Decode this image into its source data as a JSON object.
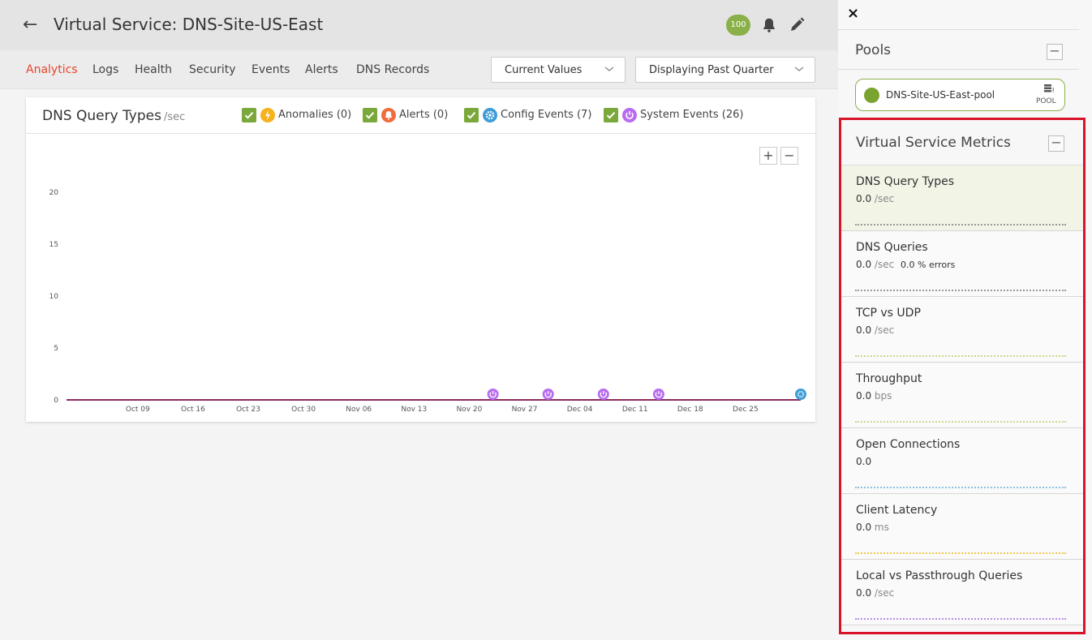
{
  "header": {
    "title": "Virtual Service: DNS-Site-US-East",
    "health_score": "100"
  },
  "tabs": [
    {
      "label": "Analytics",
      "active": true
    },
    {
      "label": "Logs"
    },
    {
      "label": "Health"
    },
    {
      "label": "Security"
    },
    {
      "label": "Events"
    },
    {
      "label": "Alerts"
    },
    {
      "label": "DNS Records"
    }
  ],
  "controls": {
    "values_dropdown": "Current Values",
    "range_dropdown": "Displaying Past Quarter"
  },
  "chart_card": {
    "title": "DNS Query Types",
    "unit": "/sec",
    "legend": [
      {
        "label": "Anomalies (0)",
        "color": "#f5b21e",
        "icon": "lightning-icon"
      },
      {
        "label": "Alerts (0)",
        "color": "#ef6c3c",
        "icon": "bell-icon"
      },
      {
        "label": "Config Events (7)",
        "color": "#3f9dd6",
        "icon": "gear-icon"
      },
      {
        "label": "System Events (26)",
        "color": "#b86cf0",
        "icon": "power-icon"
      }
    ],
    "zoom_in": "+",
    "zoom_out": "−"
  },
  "chart_data": {
    "type": "line",
    "title": "DNS Query Types",
    "ylabel": "",
    "xlabel": "",
    "ylim": [
      0,
      20
    ],
    "y_ticks": [
      0,
      5,
      10,
      15,
      20
    ],
    "x_ticks": [
      "Oct 09",
      "Oct 16",
      "Oct 23",
      "Oct 30",
      "Nov 06",
      "Nov 13",
      "Nov 20",
      "Nov 27",
      "Dec 04",
      "Dec 11",
      "Dec 18",
      "Dec 25"
    ],
    "series": [
      {
        "color": "#8b2c5c",
        "values": [
          0,
          0,
          0,
          0,
          0,
          0,
          0,
          0,
          0,
          0,
          0,
          0
        ]
      }
    ],
    "event_markers": [
      {
        "type": "system",
        "color": "#b86cf0",
        "date": "Nov 23"
      },
      {
        "type": "system",
        "color": "#b86cf0",
        "date": "Nov 30"
      },
      {
        "type": "system",
        "color": "#b86cf0",
        "date": "Dec 07"
      },
      {
        "type": "system",
        "color": "#b86cf0",
        "date": "Dec 14"
      },
      {
        "type": "config",
        "color": "#3f9dd6",
        "date": "Jan 01"
      }
    ]
  },
  "sidebar": {
    "close": "×",
    "pools_title": "Pools",
    "pool": {
      "name": "DNS-Site-US-East-pool",
      "type": "POOL"
    },
    "metrics_title": "Virtual Service Metrics",
    "metrics": [
      {
        "name": "DNS Query Types",
        "value": "0.0",
        "unit": "/sec",
        "extra": "",
        "selected": true,
        "spark_color": "#999999"
      },
      {
        "name": "DNS Queries",
        "value": "0.0",
        "unit": "/sec",
        "extra": "0.0 % errors",
        "spark_color": "#999999"
      },
      {
        "name": "TCP vs UDP",
        "value": "0.0",
        "unit": "/sec",
        "extra": "",
        "spark_color": "#c7d98a"
      },
      {
        "name": "Throughput",
        "value": "0.0",
        "unit": "bps",
        "extra": "",
        "spark_color": "#c7d98a"
      },
      {
        "name": "Open Connections",
        "value": "0.0",
        "unit": "",
        "extra": "",
        "spark_color": "#8fbfe0"
      },
      {
        "name": "Client Latency",
        "value": "0.0",
        "unit": "ms",
        "extra": "",
        "spark_color": "#f0c84a"
      },
      {
        "name": "Local vs Passthrough Queries",
        "value": "0.0",
        "unit": "/sec",
        "extra": "",
        "spark_color": "#b58ce8"
      }
    ]
  }
}
